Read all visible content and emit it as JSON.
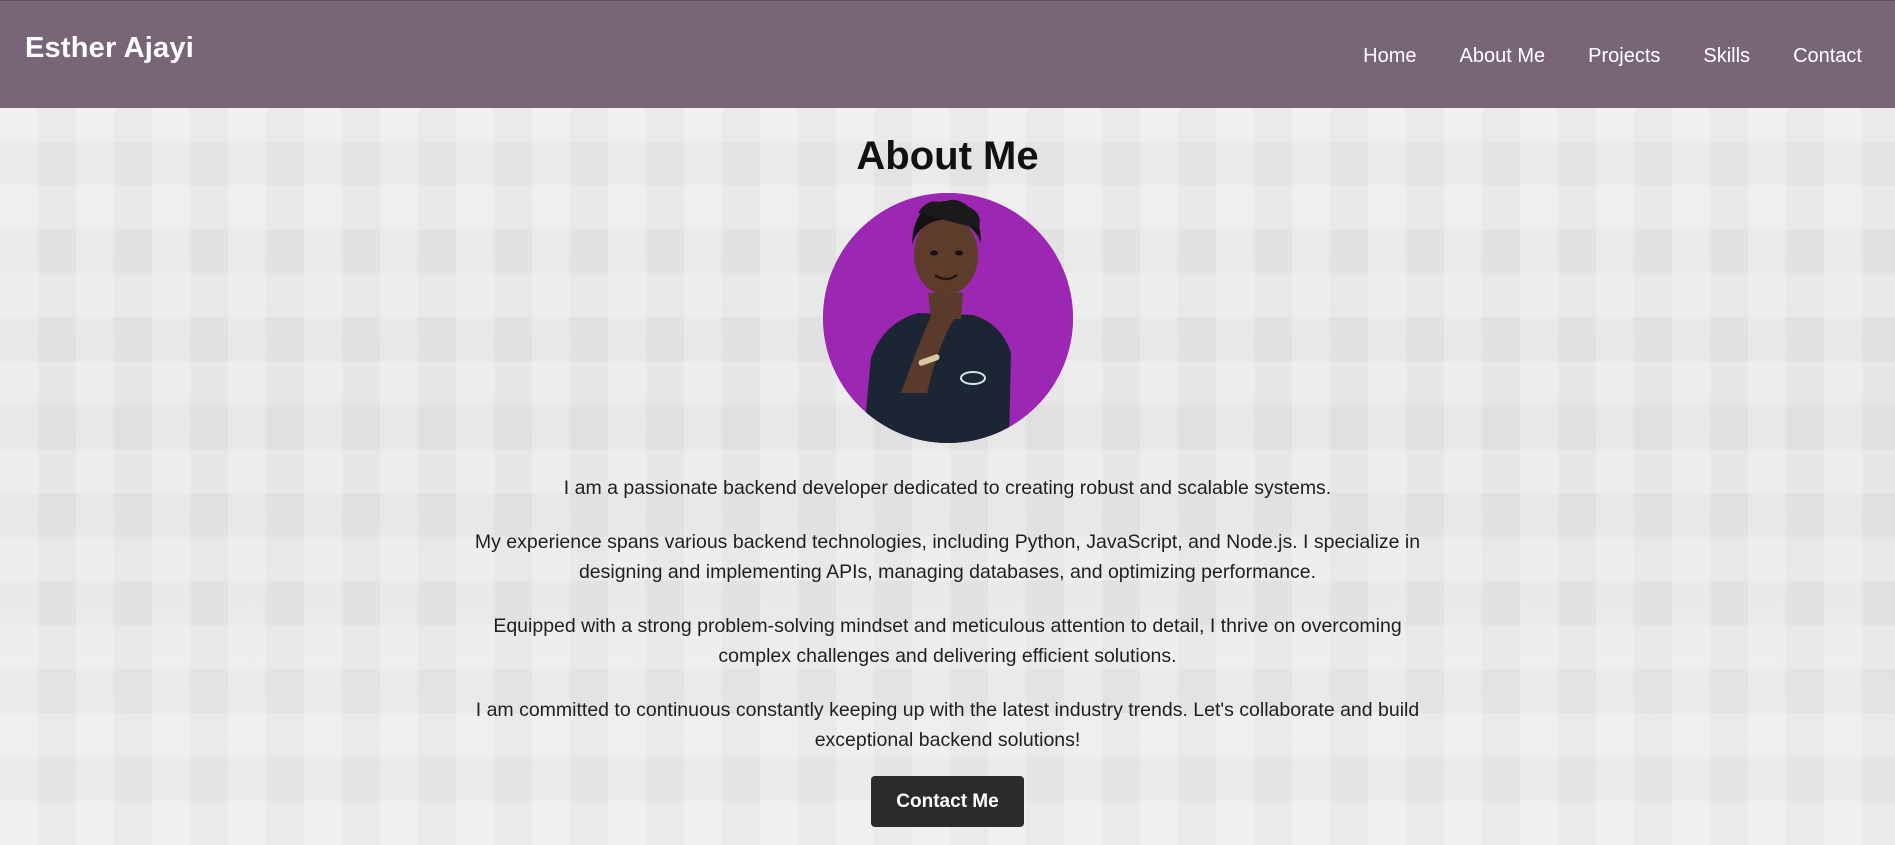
{
  "header": {
    "brand": "Esther Ajayi",
    "nav": [
      "Home",
      "About Me",
      "Projects",
      "Skills",
      "Contact"
    ]
  },
  "about": {
    "heading": "About Me",
    "paragraphs": [
      "I am a passionate backend developer dedicated to creating robust and scalable systems.",
      "My experience spans various backend technologies, including Python, JavaScript, and Node.js. I specialize in designing and implementing APIs, managing databases, and optimizing performance.",
      "Equipped with a strong problem-solving mindset and meticulous attention to detail, I thrive on overcoming complex challenges and delivering efficient solutions.",
      "I am committed to continuous constantly keeping up with the latest industry trends. Let's collaborate and build exceptional backend solutions!"
    ],
    "cta": "Contact Me"
  },
  "colors": {
    "header_bg": "#786678",
    "avatar_bg": "#9b27b3",
    "button_bg": "#2b2b2b"
  }
}
